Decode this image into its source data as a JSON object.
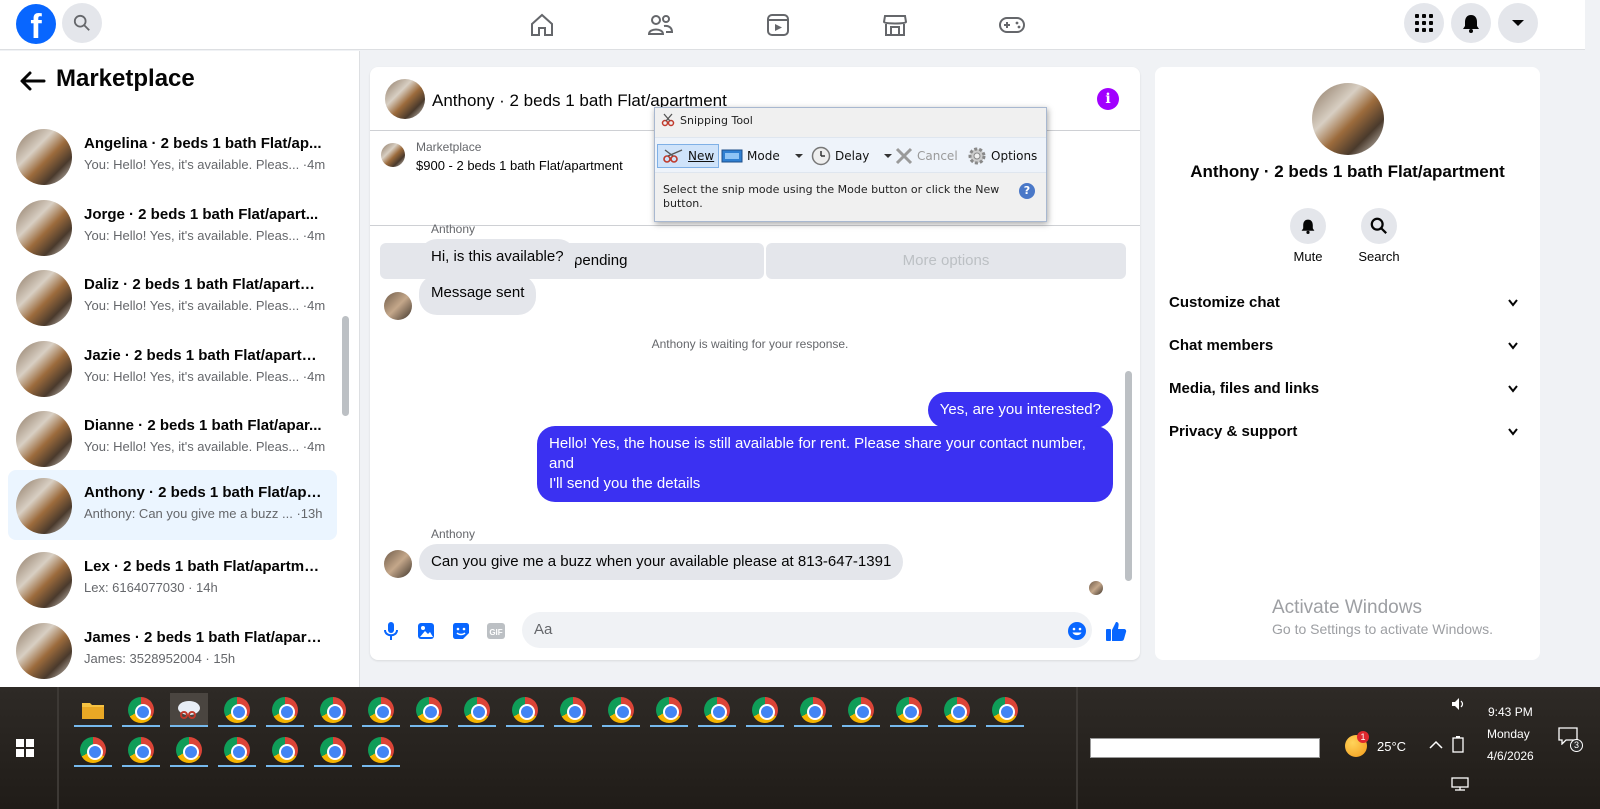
{
  "nav": {
    "logo": "f",
    "icons": [
      "home-icon",
      "friends-icon",
      "watch-icon",
      "marketplace-icon",
      "gaming-icon"
    ],
    "right_icons": [
      "menu-grid-icon",
      "notifications-icon",
      "account-chevron-icon"
    ]
  },
  "left": {
    "title": "Marketplace",
    "conversations": [
      {
        "title": "Angelina · 2 beds 1 bath Flat/ap...",
        "snippet": "You: Hello! Yes, it's available. Pleas... ·4m"
      },
      {
        "title": "Jorge · 2 beds 1 bath Flat/apart...",
        "snippet": "You: Hello! Yes, it's available. Pleas... ·4m"
      },
      {
        "title": "Daliz · 2 beds 1 bath Flat/apartm...",
        "snippet": "You: Hello! Yes, it's available. Pleas... ·4m"
      },
      {
        "title": "Jazie · 2 beds 1 bath Flat/apartm...",
        "snippet": "You: Hello! Yes, it's available. Pleas... ·4m"
      },
      {
        "title": "Dianne · 2 beds 1 bath Flat/apar...",
        "snippet": "You: Hello! Yes, it's available. Pleas... ·4m"
      },
      {
        "title": "Anthony · 2 beds 1 bath Flat/apa...",
        "snippet": "Anthony: Can you give me a buzz ... ·13h"
      },
      {
        "title": "Lex · 2 beds 1 bath Flat/apartment",
        "snippet": "Lex: 6164077030 · 14h"
      },
      {
        "title": "James · 2 beds 1 bath Flat/apart...",
        "snippet": "James: 3528952004 · 15h"
      }
    ]
  },
  "chat": {
    "header_name": "Anthony · 2 beds 1 bath Flat/apartment",
    "listing_source": "Marketplace",
    "listing_title": "$900 - 2 beds 1 bath Flat/apartment",
    "mark_pending": "Mark as pending",
    "more_options": "More options",
    "sender1": "Anthony",
    "msg1": "Hi, is this available?",
    "msg2": "Message sent",
    "system": "Anthony is waiting for your response.",
    "msg3": "Yes, are you interested?",
    "msg4_line1": "Hello! Yes, the house is still available for rent. Please share your contact number, and",
    "msg4_line2": "I'll send you the details",
    "sender2": "Anthony",
    "msg5": "Can you give me a buzz when your available please at 813-647-1391",
    "input_placeholder": "Aa"
  },
  "right": {
    "name": "Anthony · 2 beds 1 bath Flat/apartment",
    "mute": "Mute",
    "search": "Search",
    "sections": [
      "Customize chat",
      "Chat members",
      "Media, files and links",
      "Privacy & support"
    ]
  },
  "watermark": {
    "line1": "Activate Windows",
    "line2": "Go to Settings to activate Windows."
  },
  "snipping": {
    "title": "Snipping Tool",
    "new": "New",
    "mode": "Mode",
    "delay": "Delay",
    "cancel": "Cancel",
    "options": "Options",
    "message": "Select the snip mode using the Mode button or click the New button."
  },
  "taskbar": {
    "weather": "25°C",
    "time": "9:43 PM",
    "day": "Monday",
    "date": "4/6/2026",
    "notification_count": "3",
    "weather_badge": "1"
  }
}
